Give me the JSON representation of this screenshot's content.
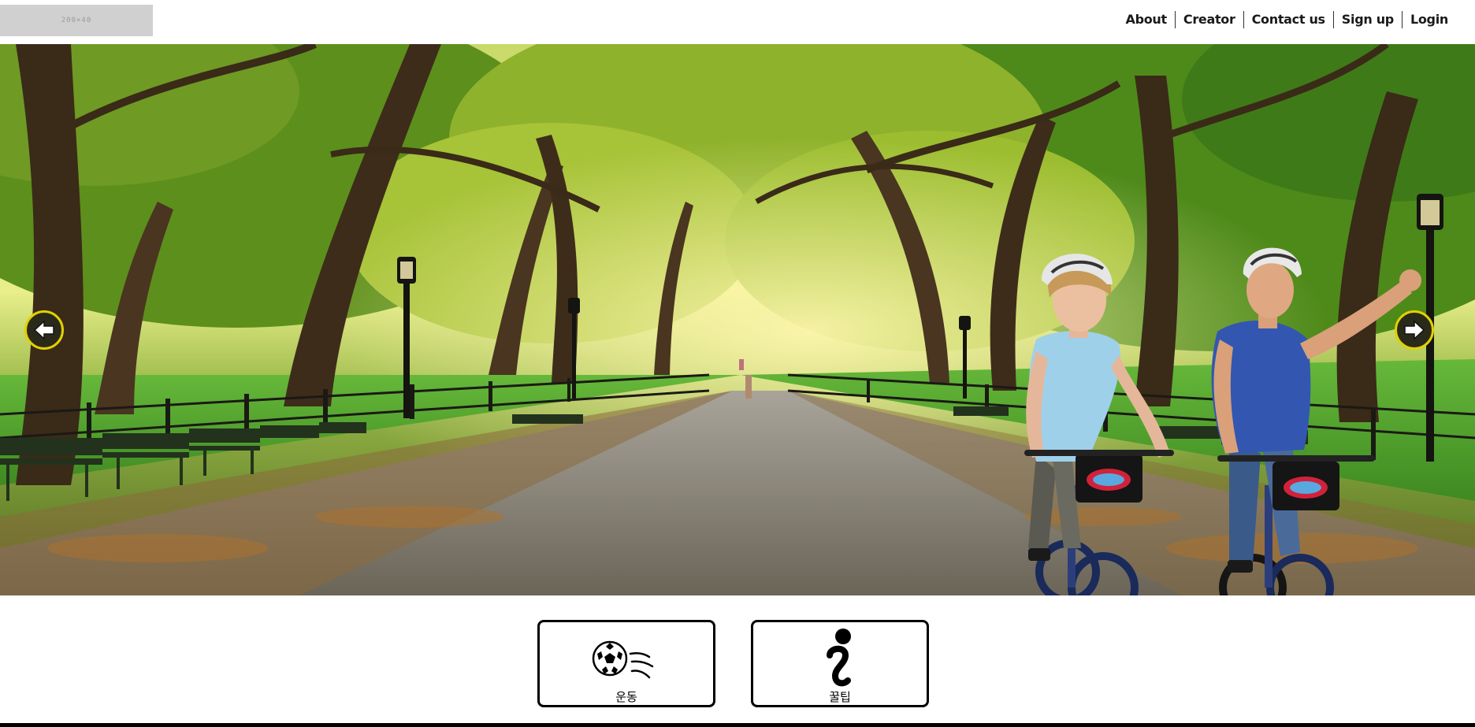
{
  "header": {
    "logo_placeholder_text": "200×40",
    "nav": [
      {
        "label": "About"
      },
      {
        "label": "Creator"
      },
      {
        "label": "Contact us"
      },
      {
        "label": "Sign up"
      },
      {
        "label": "Login"
      }
    ]
  },
  "hero": {
    "prev_icon": "arrow-left-icon",
    "next_icon": "arrow-right-icon",
    "image_subject": "park-path-cyclists-photo"
  },
  "categories": [
    {
      "label": "운동",
      "icon": "soccer-ball-icon"
    },
    {
      "label": "꿀팁",
      "icon": "info-icon"
    }
  ],
  "colors": {
    "arrow_ring": "#e2d100",
    "arrow_fill": "#2a2a1a",
    "button_border": "#000000",
    "footer_bar": "#000000"
  }
}
